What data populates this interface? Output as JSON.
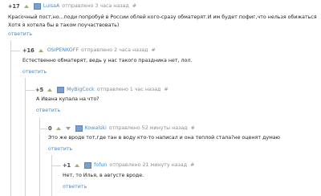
{
  "comments": [
    {
      "rating": "+17",
      "user": "LuisaA",
      "sent": "отправлено 3 часа назад",
      "hash": "#",
      "text_lines": [
        "Красочный пост,но...поди попробуй в России облей кого-сразу обматерят.И им будет пофиг,что нельзя обижаться",
        "Хотя я хотела бы в таком поучаствовать)"
      ],
      "reply": "ответить"
    },
    {
      "rating": "+16",
      "user": "OSIPENKOFF",
      "sent": "отправлено 2 часа назад",
      "hash": "#",
      "text_lines": [
        "Естественно обматерят, ведь у нас такого праздника нет, лол."
      ],
      "reply": "ответить"
    },
    {
      "rating": "+5",
      "user": "MyBigCock",
      "sent": "отправлено 1 час назад",
      "hash": "#",
      "text_lines": [
        "А Ивана купала на что?"
      ],
      "reply": "ответить"
    },
    {
      "rating": "0",
      "user": "Kowalski",
      "sent": "отправлено 52 минуты назад",
      "hash": "#",
      "text_lines": [
        "Это же вроде тот,где тан в воду кто-то написал и она теплой стала?не оценят думаю"
      ],
      "reply": "ответить"
    },
    {
      "rating": "+1",
      "user": "fofun",
      "sent": "отправлено 21 минуту назад",
      "hash": "#",
      "text_lines": [
        "Нет, то Илья, в августе вроде."
      ],
      "reply": "ответить"
    }
  ],
  "colors": {
    "username": "#4a8bc4",
    "meta": "#8a8f94",
    "thread_line": "#d4d4d4",
    "upvote": "#9bb36a"
  }
}
